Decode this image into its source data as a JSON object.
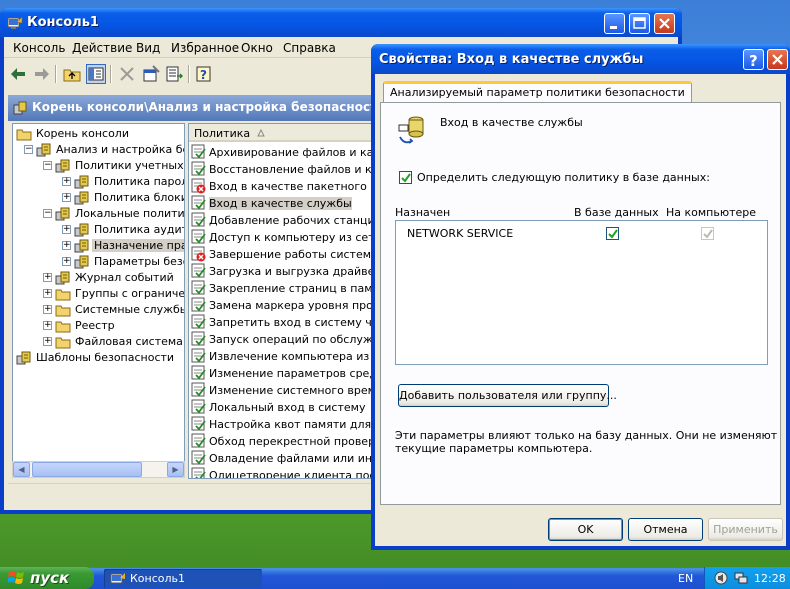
{
  "console": {
    "title": "Консоль1",
    "menu": [
      "Консоль",
      "Действие",
      "Вид",
      "Избранное",
      "Окно",
      "Справка"
    ],
    "address": "Корень консоли\\Анализ и настройка безопасности\\Л",
    "tree": [
      {
        "label": "Корень консоли",
        "level": 0,
        "toggle": "",
        "icon": "folder-icon"
      },
      {
        "label": "Анализ и настройка безо",
        "level": 1,
        "toggle": "−",
        "icon": "security-icon"
      },
      {
        "label": "Политики учетных за",
        "level": 2,
        "toggle": "−",
        "icon": "security-icon"
      },
      {
        "label": "Политика паролей",
        "level": 3,
        "toggle": "+",
        "icon": "security-icon"
      },
      {
        "label": "Политика блокиров",
        "level": 3,
        "toggle": "+",
        "icon": "security-icon"
      },
      {
        "label": "Локальные политики",
        "level": 2,
        "toggle": "−",
        "icon": "security-icon"
      },
      {
        "label": "Политика аудита",
        "level": 3,
        "toggle": "+",
        "icon": "security-icon"
      },
      {
        "label": "Назначение прав",
        "level": 3,
        "toggle": "+",
        "icon": "security-icon",
        "selected": true
      },
      {
        "label": "Параметры безоп",
        "level": 3,
        "toggle": "+",
        "icon": "security-icon"
      },
      {
        "label": "Журнал событий",
        "level": 2,
        "toggle": "+",
        "icon": "security-icon"
      },
      {
        "label": "Группы с ограничен",
        "level": 2,
        "toggle": "+",
        "icon": "folder-icon"
      },
      {
        "label": "Системные службы",
        "level": 2,
        "toggle": "+",
        "icon": "folder-icon"
      },
      {
        "label": "Реестр",
        "level": 2,
        "toggle": "+",
        "icon": "folder-icon"
      },
      {
        "label": "Файловая система",
        "level": 2,
        "toggle": "+",
        "icon": "folder-icon"
      },
      {
        "label": "Шаблоны безопасности",
        "level": 0,
        "toggle": "+",
        "icon": "security-icon"
      }
    ],
    "list_header": "Политика",
    "policies": [
      {
        "label": "Архивирование файлов и катал.",
        "status": "ok"
      },
      {
        "label": "Восстановление файлов и катал",
        "status": "ok"
      },
      {
        "label": "Вход в качестве пакетного зад.",
        "status": "error"
      },
      {
        "label": "Вход в качестве службы",
        "status": "ok",
        "selected": true
      },
      {
        "label": "Добавление рабочих станций к .",
        "status": "ok"
      },
      {
        "label": "Доступ к компьютеру из сети",
        "status": "ok"
      },
      {
        "label": "Завершение работы системы",
        "status": "error"
      },
      {
        "label": "Загрузка и выгрузка драйверов.",
        "status": "ok"
      },
      {
        "label": "Закрепление страниц в памяти",
        "status": "ok"
      },
      {
        "label": "Замена маркера уровня процесса",
        "status": "ok"
      },
      {
        "label": "Запретить вход в систему через",
        "status": "ok"
      },
      {
        "label": "Запуск операций по обслуживан",
        "status": "ok"
      },
      {
        "label": "Извлечение компьютера из сты.",
        "status": "ok"
      },
      {
        "label": "Изменение параметров среды о.",
        "status": "ok"
      },
      {
        "label": "Изменение системного времени",
        "status": "ok"
      },
      {
        "label": "Локальный вход в систему",
        "status": "ok"
      },
      {
        "label": "Настройка квот памяти для про.",
        "status": "ok"
      },
      {
        "label": "Обход перекрестной проверки",
        "status": "ok"
      },
      {
        "label": "Овладение файлами или иными .",
        "status": "ok"
      },
      {
        "label": "Олицетворение клиента после п",
        "status": "ok"
      }
    ]
  },
  "dialog": {
    "title": "Свойства: Вход в качестве службы",
    "tab": "Анализируемый параметр политики безопасности",
    "policy_name": "Вход в качестве службы",
    "define_checkbox": "Определить следующую политику в базе данных:",
    "define_checked": true,
    "columns": {
      "assigned": "Назначен",
      "database": "В базе данных",
      "computer": "На компьютере"
    },
    "rows": [
      {
        "name": "NETWORK SERVICE",
        "database": true,
        "computer": true
      }
    ],
    "add_button": "Добавить пользователя или группу...",
    "note": [
      "Эти параметры влияют только на базу данных. Они не изменяют",
      "текущие параметры компьютера."
    ],
    "ok": "OK",
    "cancel": "Отмена",
    "apply": "Применить"
  },
  "taskbar": {
    "start": "пуск",
    "task": "Консоль1",
    "lang": "EN",
    "clock": "12:28"
  }
}
